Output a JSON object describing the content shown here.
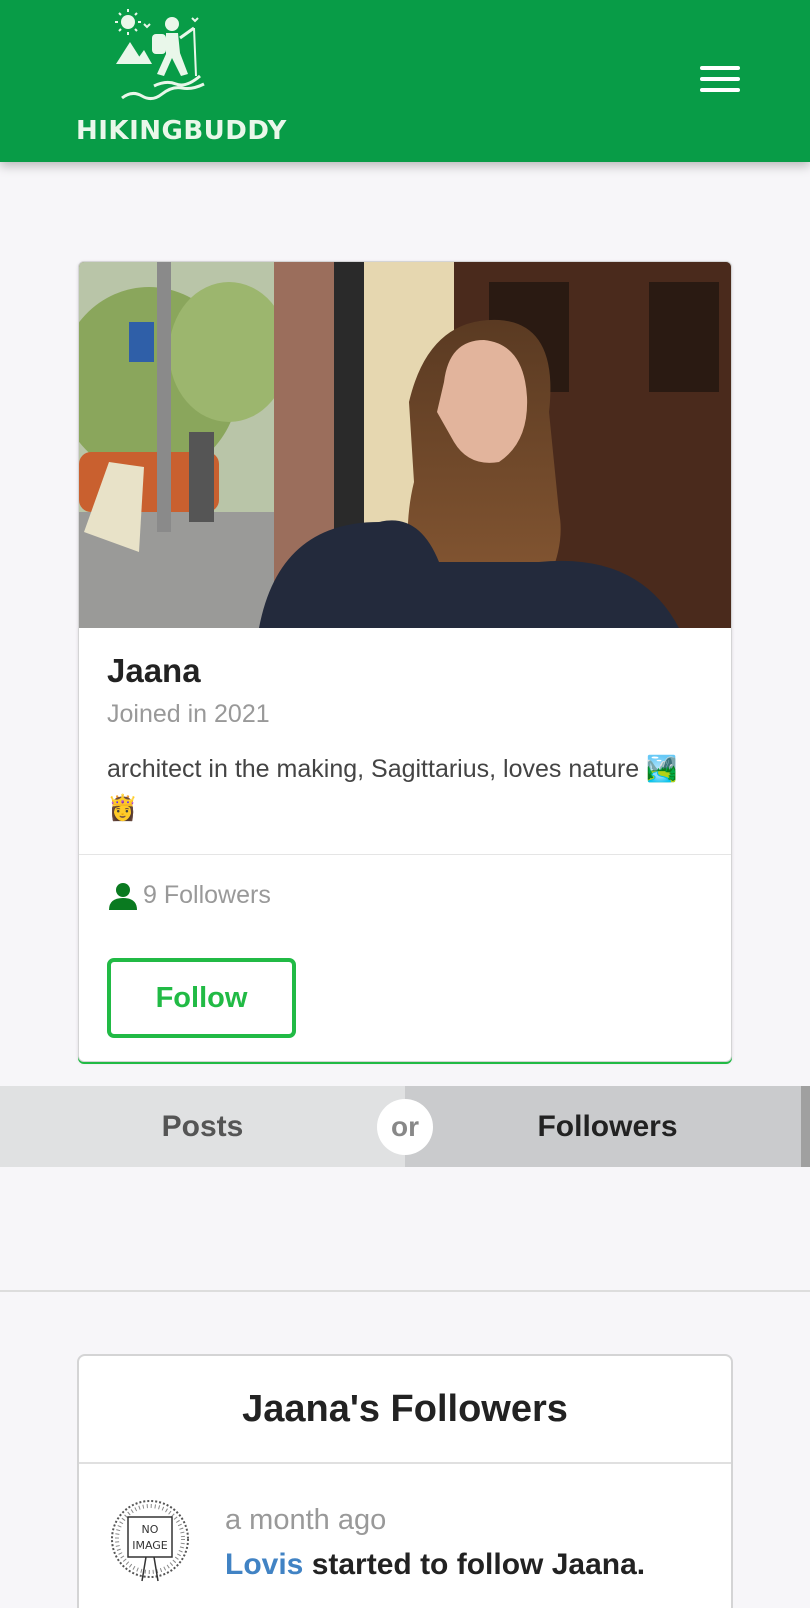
{
  "header": {
    "brand": "HIKINGBUDDY",
    "colors": {
      "bar": "#089c47",
      "logo": "#e9f7ea"
    },
    "icons": {
      "logo": "hiker-logo-icon",
      "menu": "hamburger-menu-icon"
    }
  },
  "profile": {
    "name": "Jaana",
    "joined": "Joined in 2021",
    "bio": "architect in the making, Sagittarius, loves nature 🏞️ 👸",
    "followers_count": "9 Followers",
    "follow_label": "Follow",
    "accent": "#21ba45"
  },
  "toggle": {
    "posts_label": "Posts",
    "or_label": "or",
    "followers_label": "Followers"
  },
  "followers_panel": {
    "title": "Jaana's Followers",
    "items": [
      {
        "date": "a month ago",
        "user": "Lovis",
        "text": " started to follow Jaana.",
        "avatar_text_1": "NO",
        "avatar_text_2": "IMAGE"
      }
    ]
  }
}
